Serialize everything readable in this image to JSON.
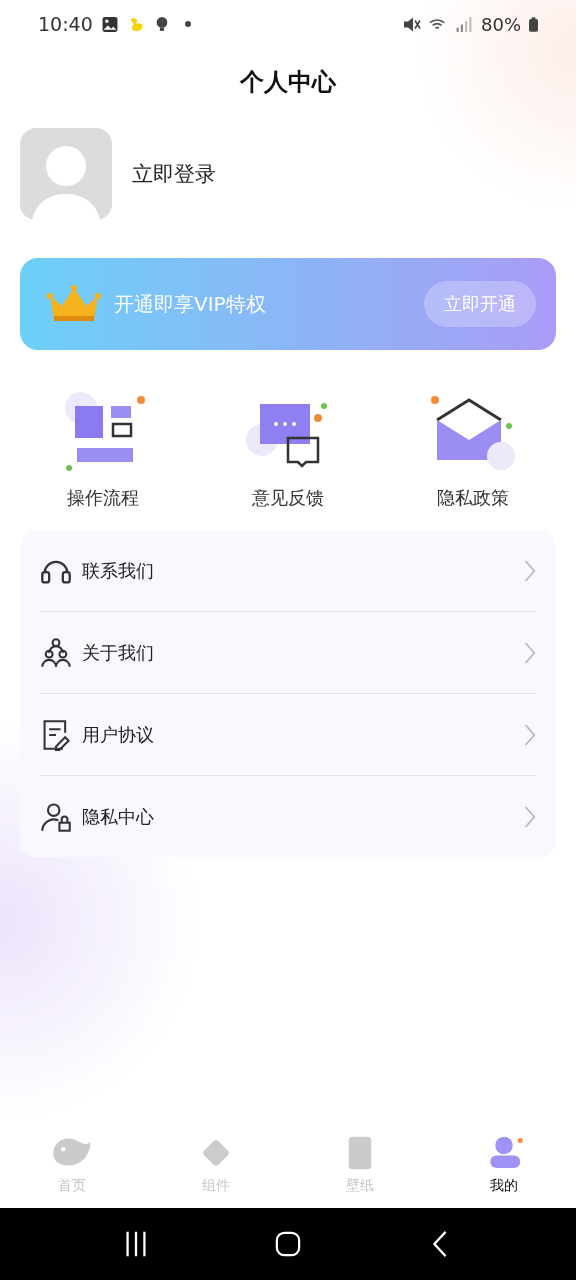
{
  "status_bar": {
    "time": "10:40",
    "battery": "80%"
  },
  "header": {
    "title": "个人中心"
  },
  "profile": {
    "login": "立即登录"
  },
  "vip_banner": {
    "text": "开通即享VIP特权",
    "button": "立即开通"
  },
  "quick_actions": [
    {
      "kind": "flow",
      "label": "操作流程"
    },
    {
      "kind": "feedback",
      "label": "意见反馈"
    },
    {
      "kind": "privacy",
      "label": "隐私政策"
    }
  ],
  "menu": [
    {
      "kind": "contact",
      "label": "联系我们"
    },
    {
      "kind": "about",
      "label": "关于我们"
    },
    {
      "kind": "agreement",
      "label": "用户协议"
    },
    {
      "kind": "privacy",
      "label": "隐私中心"
    }
  ],
  "tabs": [
    {
      "kind": "home",
      "label": "首页",
      "selected": false
    },
    {
      "kind": "widget",
      "label": "组件",
      "selected": false
    },
    {
      "kind": "wallpaper",
      "label": "壁纸",
      "selected": false
    },
    {
      "kind": "mine",
      "label": "我的",
      "selected": true
    }
  ]
}
